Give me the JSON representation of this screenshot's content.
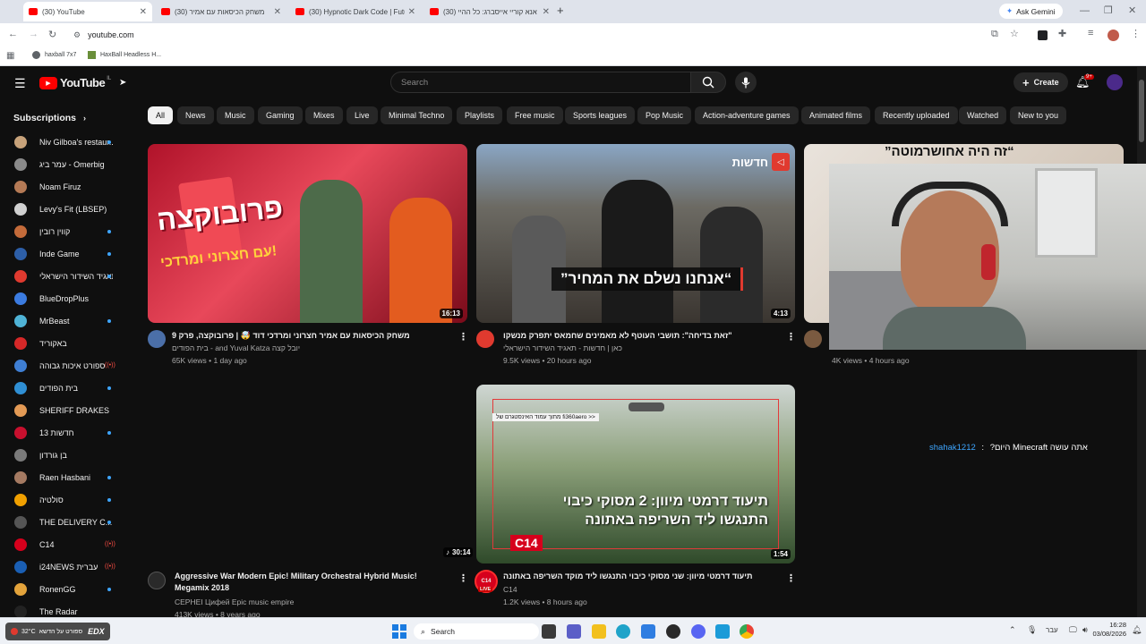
{
  "browser": {
    "tabs": [
      {
        "title": "(30) YouTube"
      },
      {
        "title": "(30) משחק הכיסאות עם אמיר"
      },
      {
        "title": "(30) Hypnotic Dark Code | Futu"
      },
      {
        "title": "(30) אנא קוריי אייסברג: כל ההיי"
      }
    ],
    "new_tab": "+",
    "ask_gemini": "Ask Gemini",
    "url": "youtube.com",
    "bookmarks": [
      {
        "label": "haxball 7x7"
      },
      {
        "label": "HaxBall Headless H..."
      }
    ]
  },
  "youtube": {
    "logo_text": "YouTube",
    "logo_region": "IL",
    "search_placeholder": "Search",
    "create_label": "Create",
    "notif_count": "9+",
    "chips": [
      "All",
      "News",
      "Music",
      "Gaming",
      "Mixes",
      "Live",
      "Minimal Techno",
      "Playlists",
      "Free music",
      "Sports leagues",
      "Pop Music",
      "Action-adventure games",
      "Animated films",
      "Recently uploaded",
      "Watched",
      "New to you"
    ],
    "sidebar": {
      "heading": "Subscriptions",
      "items": [
        {
          "label": "Niv Gilboa's restaur...",
          "color": "#c7a27a",
          "mark": "dot"
        },
        {
          "label": "עמר ביג - Omerbig",
          "color": "#8a8a8a",
          "mark": "none"
        },
        {
          "label": "Noam Firuz",
          "color": "#b57a55",
          "mark": "none"
        },
        {
          "label": "Levy's Fit (LBSEP)",
          "color": "#d0d0d0",
          "mark": "none"
        },
        {
          "label": "קווין רובין",
          "color": "#c46b3a",
          "mark": "dot"
        },
        {
          "label": "Inde Game",
          "color": "#2d5fa8",
          "mark": "dot"
        },
        {
          "label": "תאגיד השידור הישראלי...",
          "color": "#e03a2f",
          "mark": "dot"
        },
        {
          "label": "BlueDropPlus",
          "color": "#3b7be0",
          "mark": "none"
        },
        {
          "label": "MrBeast",
          "color": "#4fb3d6",
          "mark": "dot"
        },
        {
          "label": "באקוריד",
          "color": "#d62828",
          "mark": "none"
        },
        {
          "label": "ספורט איכות גבוהה",
          "color": "#3f7fd4",
          "mark": "live"
        },
        {
          "label": "בית הפודים",
          "color": "#2f8fd4",
          "mark": "dot"
        },
        {
          "label": "SHERIFF DRAKES",
          "color": "#e39a55",
          "mark": "none"
        },
        {
          "label": "13 חדשות",
          "color": "#c8102e",
          "mark": "dot"
        },
        {
          "label": "בן גורדון",
          "color": "#7a7a7a",
          "mark": "none"
        },
        {
          "label": "Raen Hasbani",
          "color": "#a57a62",
          "mark": "dot"
        },
        {
          "label": "סולטיה",
          "color": "#f0a000",
          "mark": "dot"
        },
        {
          "label": "THE DELIVERY C...",
          "color": "#555555",
          "mark": "dot"
        },
        {
          "label": "C14",
          "color": "#d6001c",
          "mark": "live"
        },
        {
          "label": "i24NEWS עברית",
          "color": "#1a5fb4",
          "mark": "live"
        },
        {
          "label": "RonenGG",
          "color": "#e3a33b",
          "mark": "dot"
        },
        {
          "label": "The Radar",
          "color": "#222222",
          "mark": "none"
        }
      ]
    },
    "videos": [
      {
        "duration": "16:13",
        "title": "משחק הכיסאות עם אמיר חצרוני ומרדכי דוד 🤯 | פרובוקצה, פרק 9",
        "channel": "יובל קצה and Yuval Katza - בית הפודים",
        "meta": "65K views • 1 day ago",
        "thumb_text1": "פרובוקצה",
        "thumb_text2": "עם חצרוני ומרדכי!"
      },
      {
        "duration": "4:13",
        "title": "\"זאת בדיחה\": תושבי העוטף לא מאמינים שחמאס יתפרק מנשקו",
        "channel": "כאן | חדשות - תאגיד השידור הישראלי",
        "meta": "9.5K views • 20 hours ago",
        "thumb_badge": "חדשות",
        "thumb_quote": "”אנחנו נשלם את המחיר“"
      },
      {
        "duration": "",
        "title": "",
        "channel": "",
        "meta": "4K views • 4 hours ago",
        "thumb_text1": "”זה היה אחושרמוטה“"
      },
      {
        "duration": "30:14",
        "title": "Aggressive War Modern Epic! Military Orchestral Hybrid Music! Megamix 2018",
        "channel": "CEPHEI Цифей Epic music empire",
        "meta": "413K views • 8 years ago"
      },
      {
        "duration": "1:54",
        "title": "תיעוד דרמטי מיוון: שני מסוקי כיבוי התנגשו ליד מוקד השריפה באתונה",
        "channel": "C14",
        "meta": "1.2K views • 8 hours ago",
        "thumb_caption": "מתוך עמוד האינסטגרם של fi360aero >>",
        "thumb_headline1": "תיעוד דרמטי מיוון: 2 מסוקי כיבוי",
        "thumb_headline2": "התנגשו ליד השריפה באתונה",
        "thumb_logo": "C14",
        "channel_badge": "LIVE"
      }
    ],
    "overlay_chat": {
      "user": "shahak1212",
      "message": "אתה עושה Minecraft היום?"
    }
  },
  "taskbar": {
    "weather": "32°C",
    "weather_sub": "ספורט על הדשא",
    "brand": "EDX",
    "search_label": "Search",
    "lang": "עבר",
    "time": "16:28",
    "date": "03/08/2026"
  }
}
